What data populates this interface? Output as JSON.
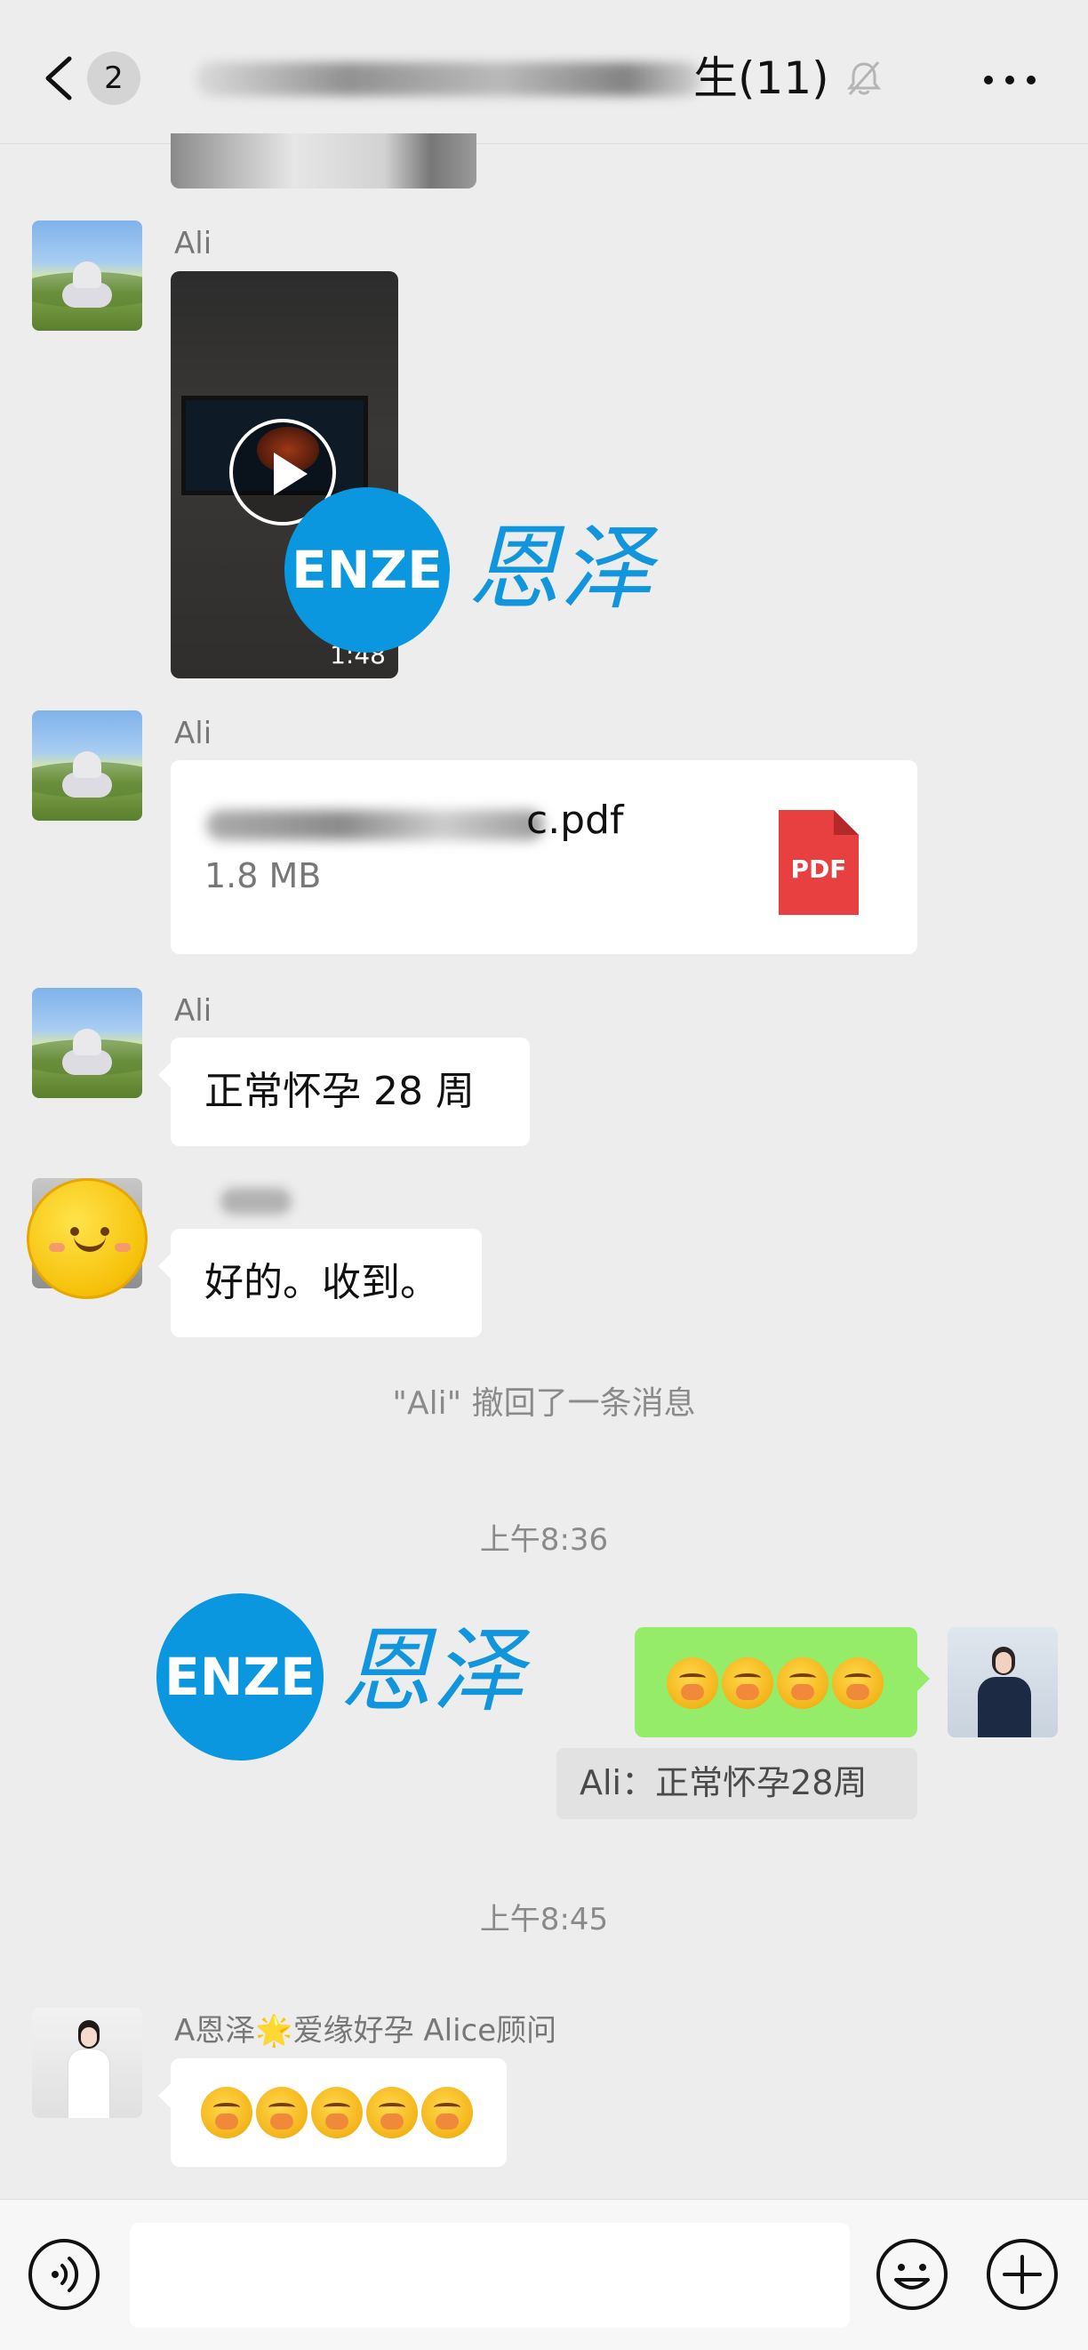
{
  "header": {
    "unread_count": "2",
    "title": "生(11)",
    "back_icon": "chevron-left-icon",
    "mute_icon": "bell-muted-icon",
    "more_icon": "more-dots-icon"
  },
  "messages": {
    "video_msg": {
      "sender": "Ali",
      "duration": "1:48"
    },
    "file_msg": {
      "sender": "Ali",
      "file_name": "c.pdf",
      "file_size": "1.8 MB",
      "file_type": "PDF"
    },
    "text_msg_ali": {
      "sender": "Ali",
      "text": "正常怀孕 28 周"
    },
    "text_msg_reply": {
      "text": "好的。收到。"
    },
    "recall_notice": "\"Ali\" 撤回了一条消息",
    "timestamp_1": "上午8:36",
    "own_msg": {
      "quote": "Ali：正常怀孕28周"
    },
    "timestamp_2": "上午8:45",
    "alice_msg": {
      "sender": "A恩泽🌟爱缘好孕 Alice顾问"
    }
  },
  "watermark": {
    "logo_text": "ENZE",
    "cn_text": "恩泽"
  },
  "input_bar": {
    "voice_icon": "voice-icon",
    "emoji_icon": "emoji-icon",
    "plus_icon": "plus-icon"
  },
  "colors": {
    "self_bubble": "#95ec69",
    "pdf_red": "#e84040",
    "watermark_blue": "#0a97e0"
  }
}
